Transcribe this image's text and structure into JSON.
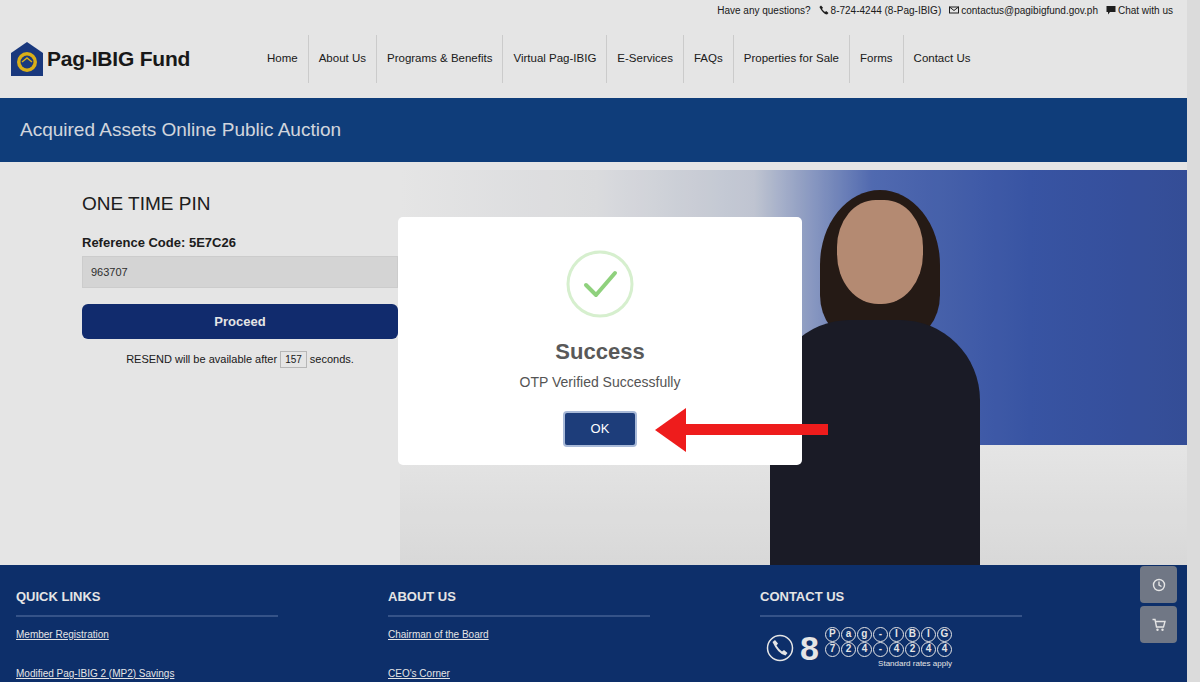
{
  "top_bar": {
    "question": "Have any questions?",
    "phone": "8-724-4244 (8-Pag-IBIG)",
    "email": "contactus@pagibigfund.gov.ph",
    "chat": "Chat with us"
  },
  "logo": {
    "text": "Pag-IBIG Fund"
  },
  "nav": [
    "Home",
    "About Us",
    "Programs & Benefits",
    "Virtual Pag-IBIG",
    "E-Services",
    "FAQs",
    "Properties for Sale",
    "Forms",
    "Contact Us"
  ],
  "banner": {
    "title": "Acquired Assets Online Public Auction"
  },
  "otp_form": {
    "title": "ONE TIME PIN",
    "reference": "Reference Code: 5E7C26",
    "value": "963707",
    "button": "Proceed",
    "resend_before": "RESEND will be available after",
    "countdown": "157",
    "resend_after": "seconds."
  },
  "modal": {
    "title": "Success",
    "message": "OTP Verified Successfully",
    "button": "OK"
  },
  "footer": {
    "columns": [
      {
        "heading": "QUICK LINKS",
        "links": [
          "Member Registration",
          "Modified Pag-IBIG 2 (MP2) Savings"
        ]
      },
      {
        "heading": "ABOUT US",
        "links": [
          "Chairman of the Board",
          "CEO's Corner"
        ]
      },
      {
        "heading": "CONTACT US",
        "links": []
      }
    ],
    "contact": {
      "digit": "8",
      "brand": "Pag-IBIG",
      "number": "724-4244",
      "note": "Standard rates apply"
    }
  }
}
